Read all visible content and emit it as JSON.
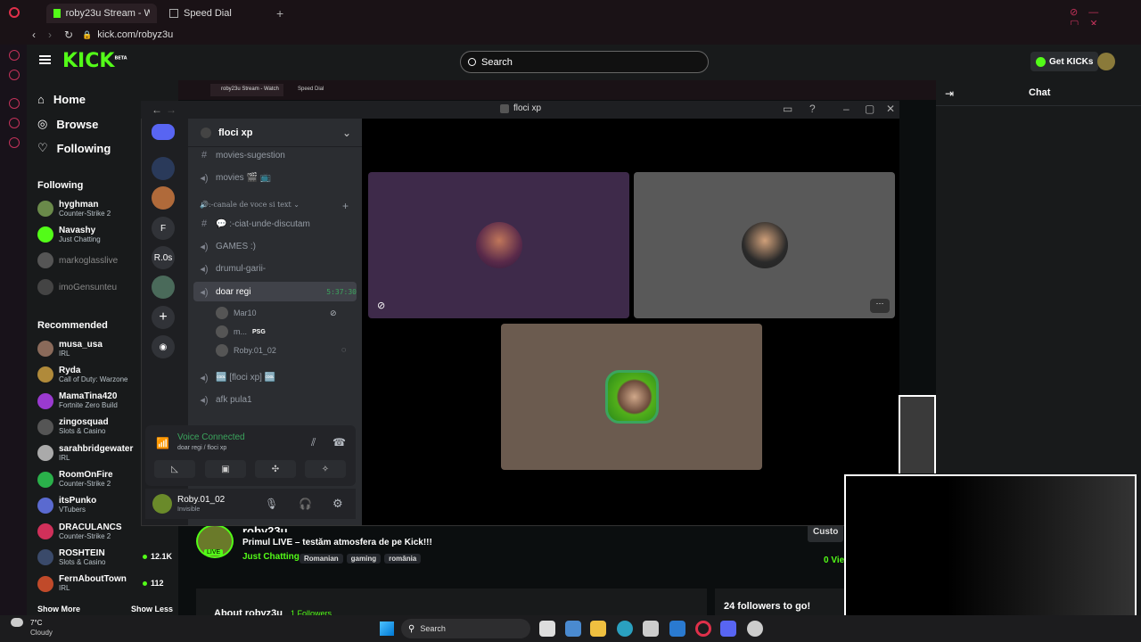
{
  "browser": {
    "tabs": [
      {
        "label": "roby23u Stream - Watch l"
      },
      {
        "label": "Speed Dial"
      }
    ],
    "url": "kick.com/robyz3u",
    "mini_tabs": [
      {
        "label": "roby23u Stream - Watch"
      },
      {
        "label": "Speed Dial"
      }
    ]
  },
  "kick": {
    "logo": "KICK",
    "logo_sup": "BETA",
    "search_placeholder": "Search",
    "get_kicks": "Get KICKs",
    "nav": [
      {
        "label": "Home",
        "icon": "home-icon"
      },
      {
        "label": "Browse",
        "icon": "compass-icon"
      },
      {
        "label": "Following",
        "icon": "heart-icon"
      }
    ],
    "following_title": "Following",
    "following": [
      {
        "name": "hyghman",
        "cat": "Counter-Strike 2",
        "color": "#6a8a4a"
      },
      {
        "name": "Navashy",
        "cat": "Just Chatting",
        "color": "#53fc18"
      },
      {
        "name": "markoglasslive",
        "cat": "",
        "color": "#555"
      },
      {
        "name": "imoGensunteu",
        "cat": "",
        "color": "#444"
      }
    ],
    "recommended_title": "Recommended",
    "recommended": [
      {
        "name": "musa_usa",
        "cat": "IRL",
        "color": "#8a6a5a",
        "viewers": ""
      },
      {
        "name": "Ryda",
        "cat": "Call of Duty: Warzone",
        "color": "#b08a3a",
        "viewers": ""
      },
      {
        "name": "MamaTina420",
        "cat": "Fortnite Zero Build",
        "color": "#9a3ad0",
        "viewers": ""
      },
      {
        "name": "zingosquad",
        "cat": "Slots & Casino",
        "color": "#555",
        "viewers": ""
      },
      {
        "name": "sarahbridgewater",
        "cat": "IRL",
        "color": "#aaa",
        "viewers": ""
      },
      {
        "name": "RoomOnFire",
        "cat": "Counter-Strike 2",
        "color": "#2ab04a",
        "viewers": ""
      },
      {
        "name": "itsPunko",
        "cat": "VTubers",
        "color": "#5a6ad0",
        "viewers": ""
      },
      {
        "name": "DRACULANCS",
        "cat": "Counter-Strike 2",
        "color": "#d0305a",
        "viewers": ""
      },
      {
        "name": "ROSHTEIN",
        "cat": "Slots & Casino",
        "color": "#3a4a6a",
        "viewers": "12.1K"
      },
      {
        "name": "FernAboutTown",
        "cat": "IRL",
        "color": "#c04a2a",
        "viewers": "112"
      }
    ],
    "show_more": "Show More",
    "show_less": "Show Less",
    "chat_title": "Chat",
    "stream": {
      "channel": "roby23u",
      "title": "Primul LIVE – testăm atmosfera de pe Kick!!!",
      "category": "Just Chatting",
      "tags": [
        "Romanian",
        "gaming",
        "românia"
      ],
      "live_badge": "LIVE",
      "customize": "Custo",
      "viewers": "0 Vie",
      "about": "About robyz3u",
      "followers": "1 Followers",
      "goal": "24 followers to go!"
    }
  },
  "discord": {
    "window_title": "floci xp",
    "server_name": "floci xp",
    "guilds": [
      {
        "label": "",
        "color": "#2a3a5a"
      },
      {
        "label": "",
        "color": "#b06a3a"
      },
      {
        "label": "F",
        "color": "#313338"
      },
      {
        "label": "R.0s",
        "color": "#313338"
      },
      {
        "label": "",
        "color": "#4a6a5a"
      }
    ],
    "channels": [
      {
        "label": "movies-sugestion",
        "icon": "#",
        "type": "text"
      },
      {
        "label": "movies 🎬 📺",
        "icon": "🔊",
        "type": "voice"
      }
    ],
    "category_label": "🔊:-canale de voce si text",
    "channels2": [
      {
        "label": "💬 :-ciat-unde-discutam",
        "icon": "#",
        "type": "text"
      },
      {
        "label": "GAMES :)",
        "icon": "🔊",
        "type": "voice"
      },
      {
        "label": "drumul-garii-",
        "icon": "🔊",
        "type": "voice"
      },
      {
        "label": "doar regi",
        "icon": "🔊",
        "type": "voice",
        "timer": "5:37:30",
        "active": true
      }
    ],
    "members": [
      {
        "name": "Mar10",
        "extra": ""
      },
      {
        "name": "m...",
        "extra": "PSG"
      },
      {
        "name": "Roby.01_02",
        "extra": ""
      }
    ],
    "channels3": [
      {
        "label": "🆒 [floci xp] 🆒",
        "icon": "🔊"
      },
      {
        "label": "afk pula1",
        "icon": "🔊"
      }
    ],
    "voice": {
      "status": "Voice Connected",
      "location": "doar regi / floci xp"
    },
    "user": {
      "name": "Roby.01_02",
      "status": "Invisible"
    }
  },
  "taskbar": {
    "weather_temp": "7°C",
    "weather_desc": "Cloudy",
    "search": "Search"
  }
}
